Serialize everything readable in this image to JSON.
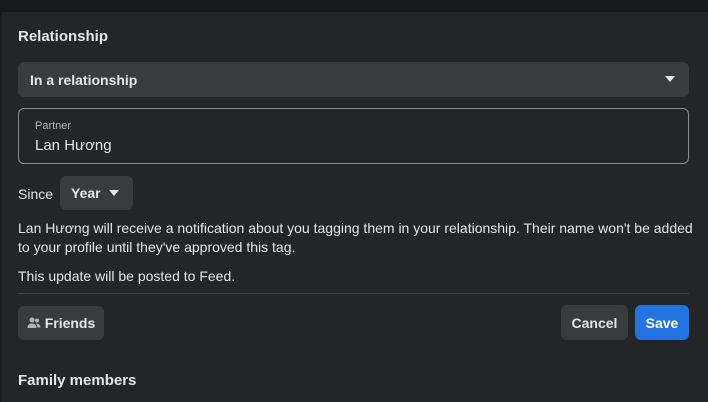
{
  "relationship": {
    "section_title": "Relationship",
    "status_value": "In a relationship",
    "partner_label": "Partner",
    "partner_value": "Lan Hương",
    "since_label": "Since",
    "year_value": "Year",
    "notice_text": "Lan Hương will receive a notification about you tagging them in your relationship. Their name won't be added to your profile until they've approved this tag.",
    "feed_note": "This update will be posted to Feed."
  },
  "actions": {
    "audience_label": "Friends",
    "cancel_label": "Cancel",
    "save_label": "Save"
  },
  "next_section": {
    "title": "Family members"
  },
  "colors": {
    "background": "#242526",
    "control": "#3a3b3c",
    "primary": "#2374e1",
    "text": "#e4e6eb",
    "secondary_text": "#b0b3b8"
  },
  "icons": {
    "status_dropdown": "caret-down-icon",
    "year_dropdown": "caret-down-icon",
    "audience": "friends-icon"
  }
}
